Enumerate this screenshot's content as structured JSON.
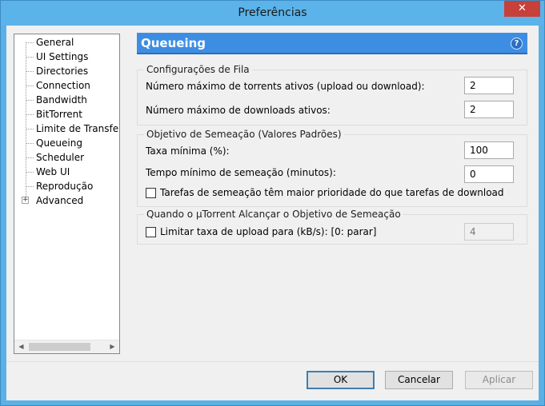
{
  "window": {
    "title": "Preferências",
    "close_icon": "close-icon"
  },
  "tree": {
    "items": [
      {
        "label": "General"
      },
      {
        "label": "UI Settings"
      },
      {
        "label": "Directories"
      },
      {
        "label": "Connection"
      },
      {
        "label": "Bandwidth"
      },
      {
        "label": "BitTorrent"
      },
      {
        "label": "Limite de Transferência"
      },
      {
        "label": "Queueing"
      },
      {
        "label": "Scheduler"
      },
      {
        "label": "Web UI"
      },
      {
        "label": "Reprodução"
      },
      {
        "label": "Advanced"
      }
    ],
    "selected": "Queueing"
  },
  "pane": {
    "title": "Queueing",
    "help_icon": "help-icon"
  },
  "queue_settings": {
    "label": "Configurações de Fila",
    "max_active_torrents_label": "Número máximo de torrents ativos (upload ou download):",
    "max_active_torrents_value": "2",
    "max_active_downloads_label": "Número máximo de downloads ativos:",
    "max_active_downloads_value": "2"
  },
  "seeding_goal": {
    "label": "Objetivo de Semeação (Valores Padrões)",
    "min_ratio_label": "Taxa mínima (%):",
    "min_ratio_value": "100",
    "min_seed_time_label": "Tempo mínimo de semeação (minutos):",
    "min_seed_time_value": "0",
    "priority_label": "Tarefas de semeação têm maior prioridade do que tarefas de download"
  },
  "when_goal_reached": {
    "label": "Quando o µTorrent Alcançar o Objetivo de Semeação",
    "limit_upload_label": "Limitar taxa de upload para (kB/s): [0: parar]",
    "limit_upload_value": "4"
  },
  "buttons": {
    "ok": "OK",
    "cancel": "Cancelar",
    "apply": "Aplicar"
  }
}
